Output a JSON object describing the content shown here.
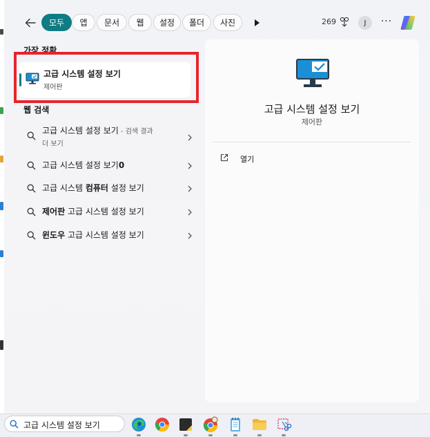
{
  "filters": {
    "items": [
      "모두",
      "앱",
      "문서",
      "웹",
      "설정",
      "폴더",
      "사진"
    ],
    "active_index": 0
  },
  "topbar": {
    "points": "269",
    "avatar_initial": "J",
    "more": "···"
  },
  "best_match": {
    "section_label": "가장 정확",
    "title": "고급 시스템 설정 보기",
    "subtitle": "제어판"
  },
  "web_search": {
    "section_label": "웹 검색",
    "items": [
      {
        "pre": "고급 시스템 설정 보기",
        "bold": "",
        "post": "",
        "hint": " - 검색 결과",
        "line2": "더 보기"
      },
      {
        "pre": "고급 시스템 설정 보기",
        "bold": "0",
        "post": "",
        "hint": "",
        "line2": ""
      },
      {
        "pre": "고급 시스템 ",
        "bold": "컴퓨터",
        "post": " 설정 보기",
        "hint": "",
        "line2": ""
      },
      {
        "pre": "",
        "bold": "제어판",
        "post": " 고급 시스템 설정 보기",
        "hint": "",
        "line2": ""
      },
      {
        "pre": "",
        "bold": "윈도우",
        "post": " 고급 시스템 설정 보기",
        "hint": "",
        "line2": ""
      }
    ]
  },
  "detail": {
    "title": "고급 시스템 설정 보기",
    "subtitle": "제어판",
    "actions": [
      {
        "label": "열기",
        "icon": "open-external-icon"
      }
    ]
  },
  "taskbar": {
    "search_value": "고급 시스템 설정 보기",
    "apps": [
      "edge-icon",
      "chrome-icon",
      "sticky-notes-icon",
      "chrome-canary-icon",
      "notepad-icon",
      "file-explorer-icon",
      "snipping-tool-icon"
    ]
  },
  "colors": {
    "accent": "#0f7b84",
    "highlight": "#e8232b"
  }
}
